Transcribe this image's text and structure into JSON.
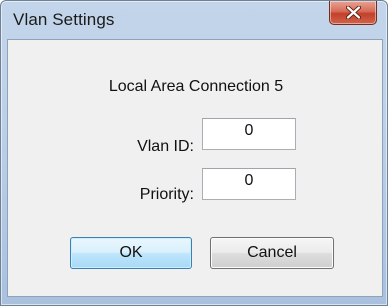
{
  "window": {
    "title": "Vlan Settings"
  },
  "dialog": {
    "heading": "Local Area Connection 5",
    "vlan_id": {
      "label": "Vlan ID:",
      "value": "0"
    },
    "priority": {
      "label": "Priority:",
      "value": "0"
    },
    "ok_label": "OK",
    "cancel_label": "Cancel"
  },
  "icons": {
    "close": "close-icon"
  },
  "colors": {
    "titlebar": "#bcd0e8",
    "close_button": "#c2402b",
    "default_button_border": "#3c7fb1",
    "client_background": "#f0f0f0"
  }
}
